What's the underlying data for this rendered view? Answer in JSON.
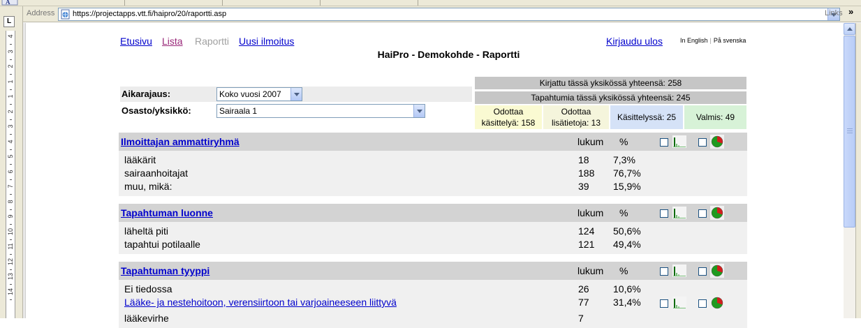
{
  "browser": {
    "address_label": "Address",
    "url": "https://projectapps.vtt.fi/haipro/20/raportti.asp",
    "links_label": "Links",
    "links_chevron": "»"
  },
  "ruler": {
    "corner_label": "L",
    "numbers": [
      "4",
      "3",
      "2",
      "1",
      "1",
      "2",
      "3",
      "4",
      "5",
      "6",
      "7",
      "8",
      "9",
      "10",
      "11",
      "12",
      "13",
      "14"
    ]
  },
  "nav": {
    "etusivu": "Etusivu",
    "lista": "Lista",
    "raportti": "Raportti",
    "uusi_ilmoitus": "Uusi ilmoitus",
    "kirjaudu_ulos": "Kirjaudu ulos",
    "in_english": "In English",
    "separator": "|",
    "pa_svenska": "På svenska"
  },
  "page_title": "HaiPro - Demokohde - Raportti",
  "filters": {
    "aikarajaus_label": "Aikarajaus:",
    "aikarajaus_value": "Koko vuosi 2007",
    "osasto_label": "Osasto/yksikkö:",
    "osasto_value": "Sairaala 1"
  },
  "stats": {
    "kirjattu": "Kirjattu tässä yksikössä yhteensä: 258",
    "tapahtumia": "Tapahtumia tässä yksikössä yhteensä: 245",
    "statuses": [
      {
        "line1": "Odottaa",
        "line2": "käsittelyä: 158",
        "color": "#fafad2"
      },
      {
        "line1": "Odottaa",
        "line2": "lisätietoja: 13",
        "color": "#f5f5dc"
      },
      {
        "line1": "Käsittelyssä: 25",
        "line2": "",
        "color": "#d5e2f7"
      },
      {
        "line1": "Valmis: 49",
        "line2": "",
        "color": "#d7f2d7"
      }
    ]
  },
  "sections": [
    {
      "title": "Ilmoittajan ammattiryhmä",
      "col_count": "lukum",
      "col_pct": "%",
      "rows": [
        {
          "label": "lääkärit",
          "count": "18",
          "pct": "7,3%",
          "linked": false
        },
        {
          "label": "sairaanhoitajat",
          "count": "188",
          "pct": "76,7%",
          "linked": false
        },
        {
          "label": "muu, mikä:",
          "count": "39",
          "pct": "15,9%",
          "linked": false
        }
      ]
    },
    {
      "title": "Tapahtuman luonne",
      "col_count": "lukum",
      "col_pct": "%",
      "rows": [
        {
          "label": "läheltä piti",
          "count": "124",
          "pct": "50,6%",
          "linked": false
        },
        {
          "label": "tapahtui potilaalle",
          "count": "121",
          "pct": "49,4%",
          "linked": false
        }
      ]
    },
    {
      "title": "Tapahtuman tyyppi",
      "col_count": "lukum",
      "col_pct": "%",
      "rows": [
        {
          "label": "Ei tiedossa",
          "count": "26",
          "pct": "10,6%",
          "linked": false
        },
        {
          "label": "Lääke- ja nestehoitoon, verensiirtoon tai varjoaineeseen liittyvä",
          "count": "77",
          "pct": "31,4%",
          "linked": true
        },
        {
          "label": "lääkevirhe",
          "count": "7",
          "pct": "",
          "linked": false
        }
      ]
    }
  ]
}
